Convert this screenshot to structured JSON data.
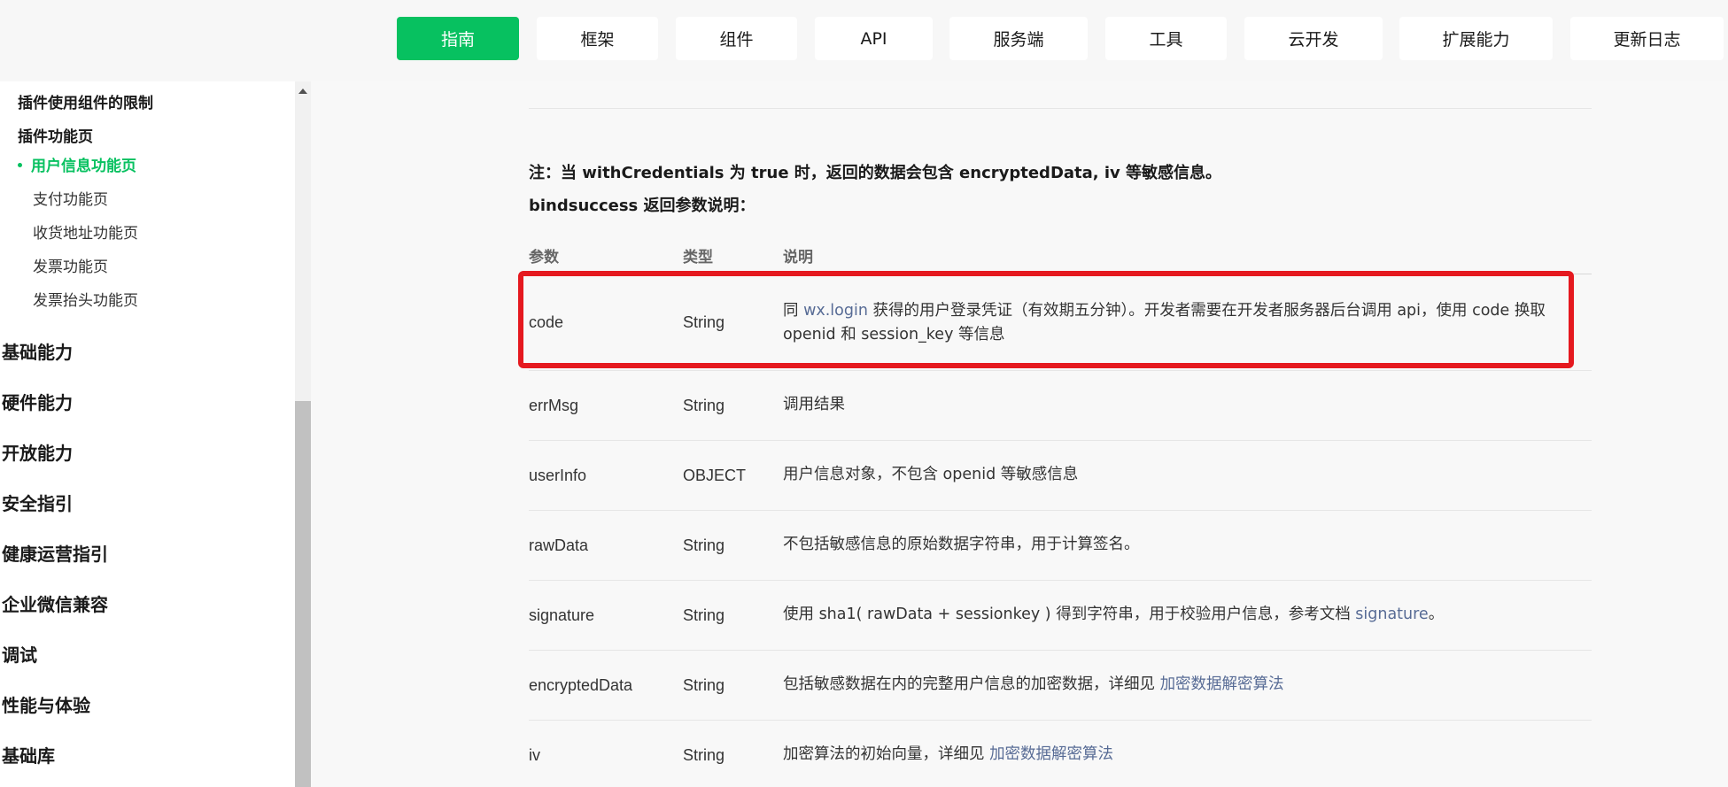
{
  "topnav": {
    "tabs": [
      {
        "label": "指南",
        "active": true
      },
      {
        "label": "框架"
      },
      {
        "label": "组件"
      },
      {
        "label": "API"
      },
      {
        "label": "服务端"
      },
      {
        "label": "工具"
      },
      {
        "label": "云开发"
      },
      {
        "label": "扩展能力"
      },
      {
        "label": "更新日志"
      }
    ],
    "accent": "#07c160"
  },
  "sidebar": {
    "items": [
      {
        "label": "插件使用组件的限制",
        "kind": "sub"
      },
      {
        "label": "插件功能页",
        "kind": "sub"
      },
      {
        "label": "用户信息功能页",
        "kind": "active"
      },
      {
        "label": "支付功能页",
        "kind": "leaf"
      },
      {
        "label": "收货地址功能页",
        "kind": "leaf"
      },
      {
        "label": "发票功能页",
        "kind": "leaf"
      },
      {
        "label": "发票抬头功能页",
        "kind": "leaf"
      },
      {
        "label": "基础能力",
        "kind": "top"
      },
      {
        "label": "硬件能力",
        "kind": "top"
      },
      {
        "label": "开放能力",
        "kind": "top"
      },
      {
        "label": "安全指引",
        "kind": "top"
      },
      {
        "label": "健康运营指引",
        "kind": "top"
      },
      {
        "label": "企业微信兼容",
        "kind": "top"
      },
      {
        "label": "调试",
        "kind": "top"
      },
      {
        "label": "性能与体验",
        "kind": "top"
      },
      {
        "label": "基础库",
        "kind": "top"
      }
    ]
  },
  "content": {
    "note1": "注：当 withCredentials 为 true 时，返回的数据会包含 encryptedData, iv 等敏感信息。",
    "note2": "bindsuccess 返回参数说明：",
    "table": {
      "headers": [
        "参数",
        "类型",
        "说明"
      ],
      "rows": [
        {
          "param": "code",
          "type": "String",
          "desc_pre": "同 ",
          "desc_link": "wx.login",
          "desc_post": " 获得的用户登录凭证（有效期五分钟）。开发者需要在开发者服务器后台调用 api，使用 code 换取 openid 和 session_key 等信息"
        },
        {
          "param": "errMsg",
          "type": "String",
          "desc_pre": "调用结果",
          "desc_link": "",
          "desc_post": ""
        },
        {
          "param": "userInfo",
          "type": "OBJECT",
          "desc_pre": "用户信息对象，不包含 openid 等敏感信息",
          "desc_link": "",
          "desc_post": ""
        },
        {
          "param": "rawData",
          "type": "String",
          "desc_pre": "不包括敏感信息的原始数据字符串，用于计算签名。",
          "desc_link": "",
          "desc_post": ""
        },
        {
          "param": "signature",
          "type": "String",
          "desc_pre": "使用 sha1( rawData + sessionkey ) 得到字符串，用于校验用户信息，参考文档 ",
          "desc_link": "signature",
          "desc_post": "。"
        },
        {
          "param": "encryptedData",
          "type": "String",
          "desc_pre": "包括敏感数据在内的完整用户信息的加密数据，详细见 ",
          "desc_link": "加密数据解密算法",
          "desc_post": ""
        },
        {
          "param": "iv",
          "type": "String",
          "desc_pre": "加密算法的初始向量，详细见 ",
          "desc_link": "加密数据解密算法",
          "desc_post": ""
        }
      ]
    },
    "highlight_color": "#e5191f",
    "link_color": "#576b95"
  }
}
